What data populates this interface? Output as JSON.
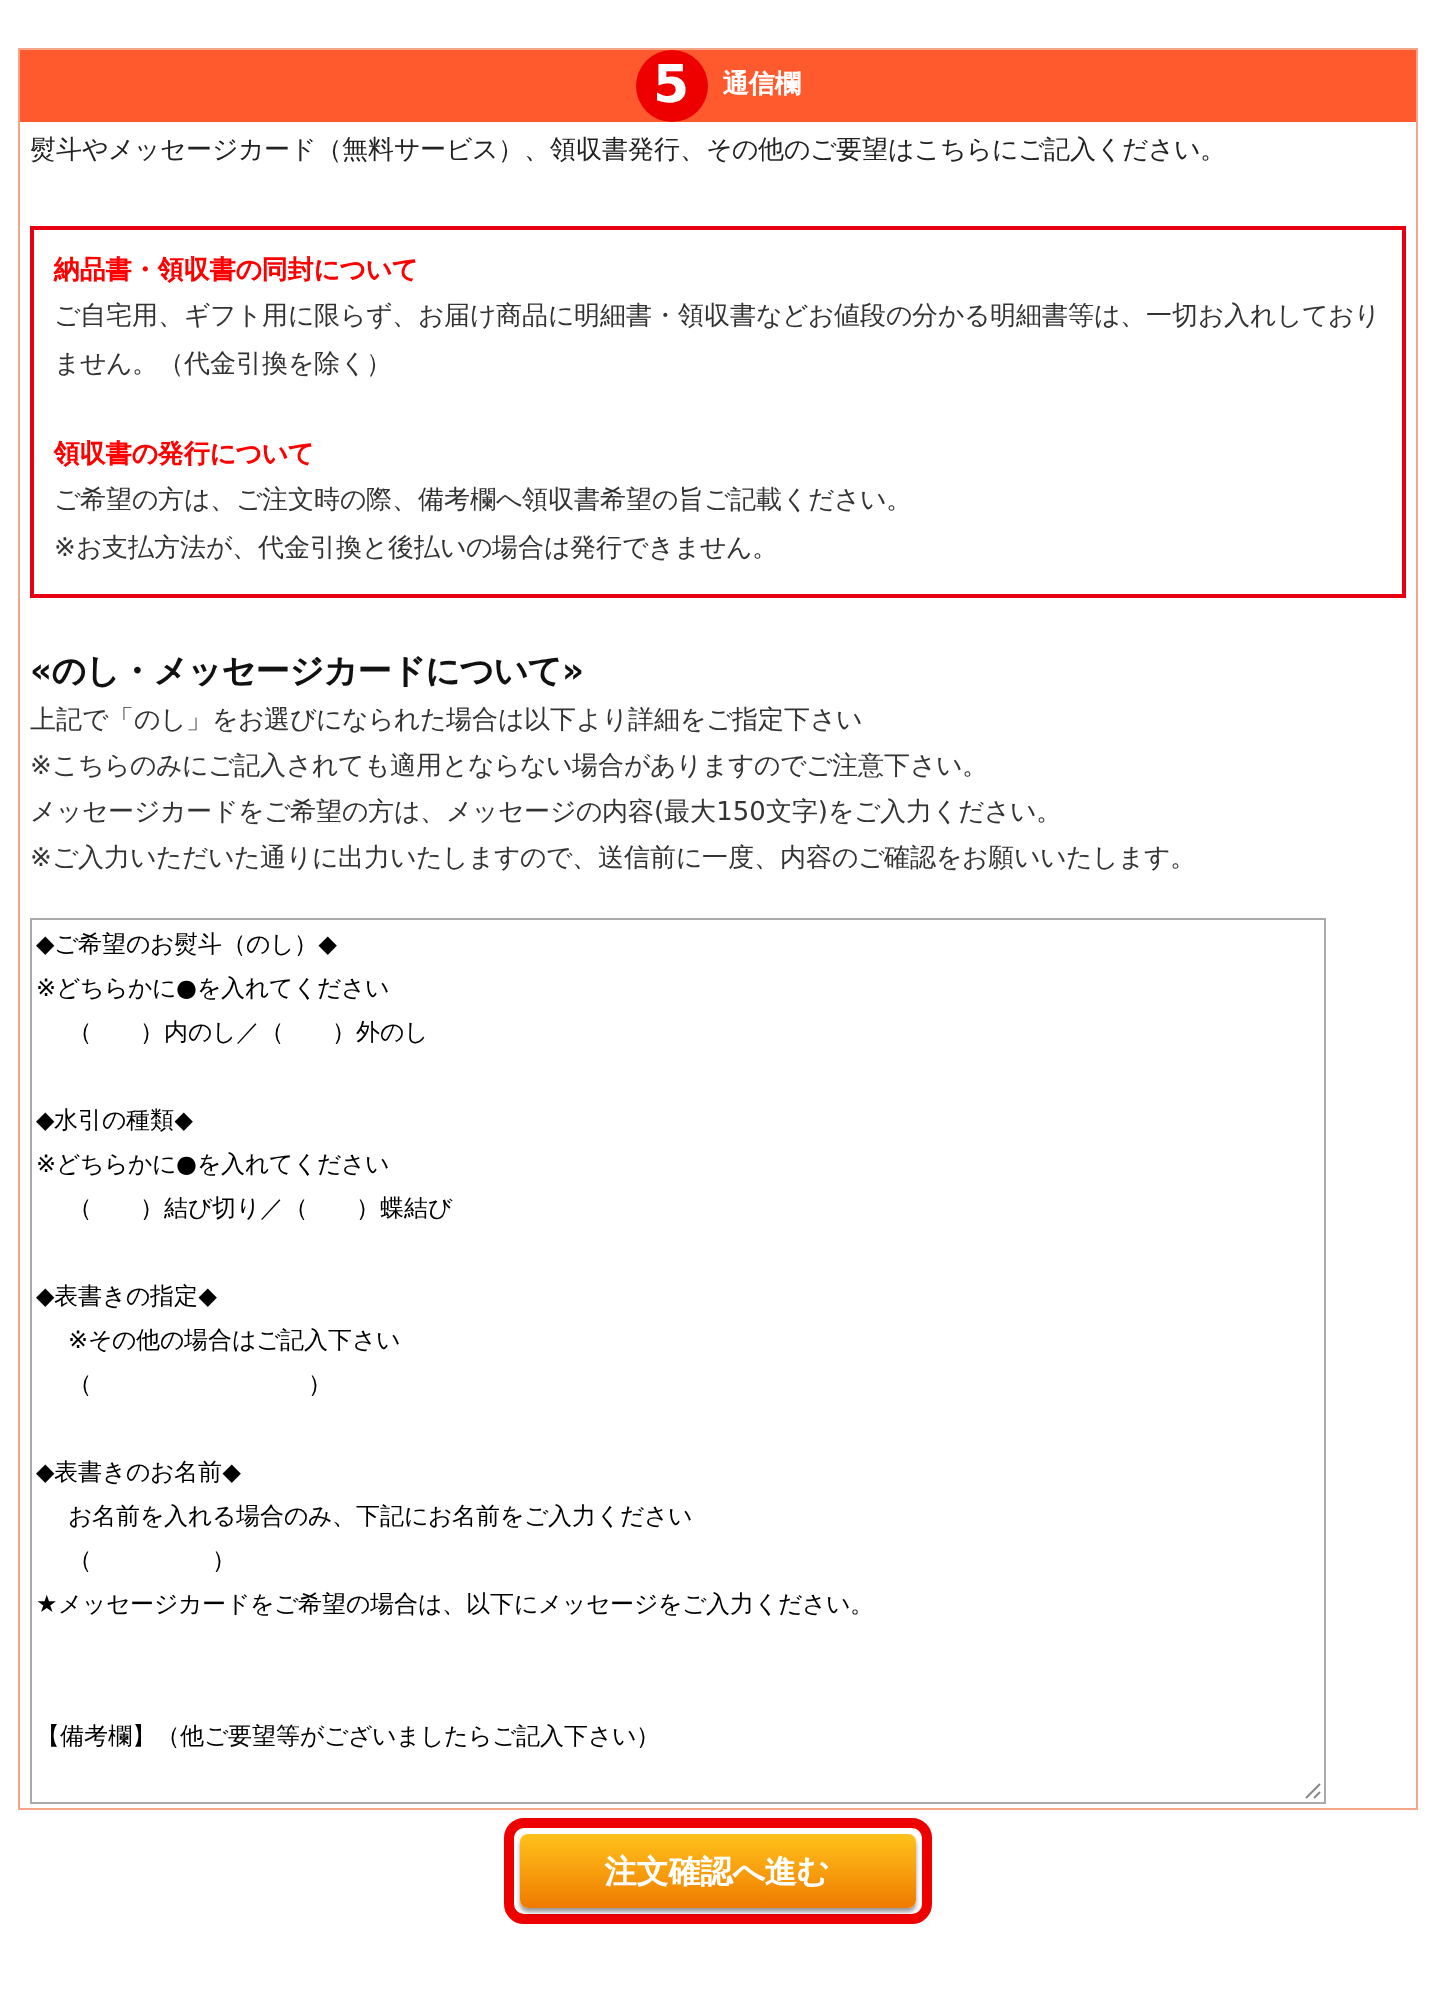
{
  "section": {
    "step": "5",
    "title": "通信欄",
    "intro": "熨斗やメッセージカード（無料サービス）、領収書発行、その他のご要望はこちらにご記入ください。",
    "notices": [
      {
        "title": "納品書・領収書の同封について",
        "lines": [
          "ご自宅用、ギフト用に限らず、お届け商品に明細書・領収書などお値段の分かる明細書等は、一切お入れしておりません。（代金引換を除く）"
        ]
      },
      {
        "title": "領収書の発行について",
        "lines": [
          "ご希望の方は、ご注文時の際、備考欄へ領収書希望の旨ご記載ください。",
          "※お支払方法が、代金引換と後払いの場合は発行できません。"
        ]
      }
    ],
    "heading": "«のし・メッセージカードについて»",
    "instructions": [
      "上記で「のし」をお選びになられた場合は以下より詳細をご指定下さい",
      "※こちらのみにご記入されても適用とならない場合がありますのでご注意下さい。",
      "メッセージカードをご希望の方は、メッセージの内容(最大150文字)をご入力ください。",
      "※ご入力いただいた通りに出力いたしますので、送信前に一度、内容のご確認をお願いいたします。"
    ],
    "message_field": {
      "blocks": [
        {
          "kind": "section",
          "lines": [
            {
              "kind": "plain",
              "text": "◆ご希望のお熨斗（のし）◆"
            },
            {
              "kind": "plain",
              "text": "※どちらかに●を入れてください"
            },
            {
              "kind": "indented",
              "text": "（　　）内のし／（　　）外のし"
            }
          ]
        },
        {
          "kind": "section",
          "lines": [
            {
              "kind": "plain",
              "text": "◆水引の種類◆"
            },
            {
              "kind": "plain",
              "text": "※どちらかに●を入れてください"
            },
            {
              "kind": "indented",
              "text": "（　　）結び切り／（　　）蝶結び"
            }
          ]
        },
        {
          "kind": "section",
          "lines": [
            {
              "kind": "plain",
              "text": "◆表書きの指定◆"
            },
            {
              "kind": "indented",
              "text": "※その他の場合はご記入下さい"
            },
            {
              "kind": "indented",
              "text": "（　　　　　　　　　）"
            }
          ]
        },
        {
          "kind": "section",
          "lines": [
            {
              "kind": "plain",
              "text": "◆表書きのお名前◆"
            },
            {
              "kind": "indented",
              "text": "お名前を入れる場合のみ、下記にお名前をご入力ください"
            },
            {
              "kind": "indented",
              "text": "（　　　　　）"
            },
            {
              "kind": "plain",
              "text": "★メッセージカードをご希望の場合は、以下にメッセージをご入力ください。"
            }
          ]
        },
        {
          "kind": "remarks",
          "lines": [
            {
              "kind": "plain",
              "text": "【備考欄】（他ご要望等がございましたらご記入下さい）"
            }
          ]
        }
      ]
    }
  },
  "submit_button": "注文確認へ進む"
}
